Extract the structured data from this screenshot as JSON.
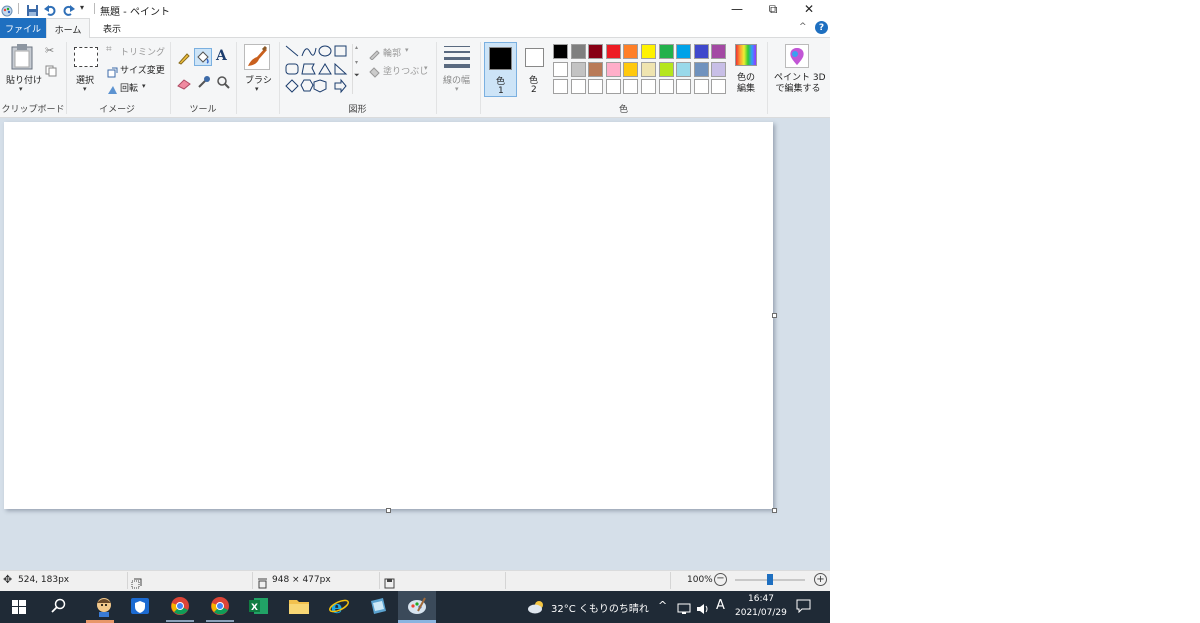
{
  "titlebar": {
    "title": "無題 - ペイント",
    "minimize": "—",
    "restore": "⧉",
    "close": "✕"
  },
  "tabs": {
    "file": "ファイル",
    "home": "ホーム",
    "view": "表示"
  },
  "ribbon": {
    "clipboard": {
      "paste": "貼り付け",
      "group": "クリップボード"
    },
    "image": {
      "select": "選択",
      "crop": "トリミング",
      "resize": "サイズ変更",
      "rotate": "回転",
      "group": "イメージ"
    },
    "tools": {
      "group": "ツール"
    },
    "brushes": {
      "label": "ブラシ"
    },
    "shapes": {
      "outline": "輪郭",
      "fill": "塗りつぶし",
      "group": "図形"
    },
    "size": {
      "label": "線の幅"
    },
    "colors": {
      "color1_label": "色",
      "color1_num": "1",
      "color2_label": "色",
      "color2_num": "2",
      "group": "色",
      "edit_colors": "色の\n編集",
      "edit_colors_l1": "色の",
      "edit_colors_l2": "編集",
      "row1": [
        "#000000",
        "#7f7f7f",
        "#880015",
        "#ed1c24",
        "#ff7f27",
        "#fff200",
        "#22b14c",
        "#00a2e8",
        "#3f48cc",
        "#a349a4"
      ],
      "row2": [
        "#ffffff",
        "#c3c3c3",
        "#b97a57",
        "#ffaec9",
        "#ffc90e",
        "#efe4b0",
        "#b5e61d",
        "#99d9ea",
        "#7092be",
        "#c8bfe7"
      ],
      "row3": [
        "#ffffff",
        "#ffffff",
        "#ffffff",
        "#ffffff",
        "#ffffff",
        "#ffffff",
        "#ffffff",
        "#ffffff",
        "#ffffff",
        "#ffffff"
      ]
    },
    "paint3d": {
      "line1": "ペイント 3D",
      "line2": "で編集する"
    }
  },
  "status": {
    "cursor": "524, 183px",
    "canvas_size": "948 × 477px",
    "zoom": "100%"
  },
  "taskbar": {
    "weather": "32°C  くもりのち晴れ",
    "ime": "A",
    "time": "16:47",
    "date": "2021/07/29"
  }
}
